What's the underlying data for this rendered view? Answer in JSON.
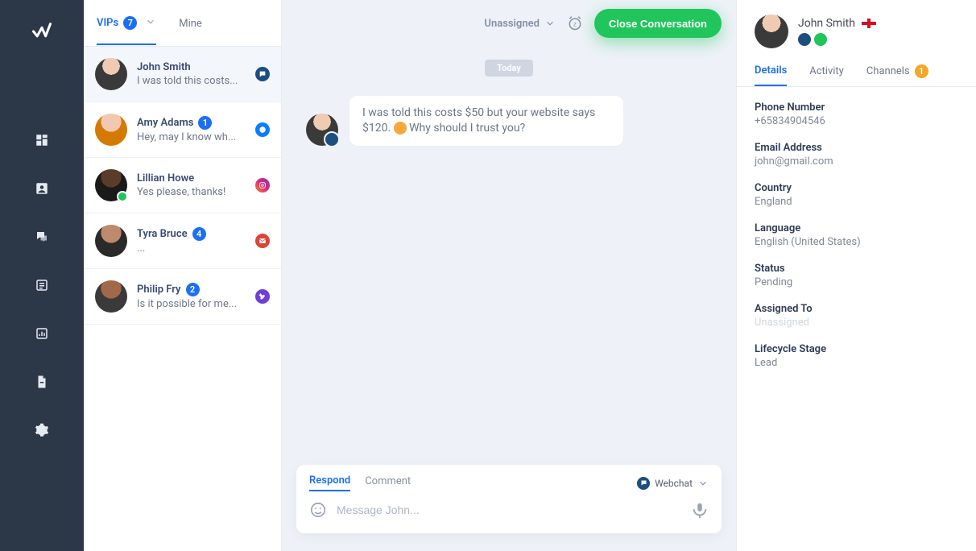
{
  "leftnav_icons": [
    "dashboard",
    "contact",
    "chat",
    "list",
    "stats",
    "file",
    "settings"
  ],
  "tabs": {
    "vips": "VIPs",
    "vips_count": "7",
    "mine": "Mine"
  },
  "conversations": [
    {
      "name": "John Smith",
      "preview": "I was told this costs...",
      "channel": "webchat"
    },
    {
      "name": "Amy Adams",
      "preview": "Hey, may I know wh...",
      "channel": "messenger",
      "badge": "1"
    },
    {
      "name": "Lillian Howe",
      "preview": "Yes please, thanks!",
      "channel": "instagram",
      "presence": true
    },
    {
      "name": "Tyra Bruce",
      "preview": "...",
      "channel": "gmail",
      "badge": "4"
    },
    {
      "name": "Philip Fry",
      "preview": "Is it possible for me...",
      "channel": "viber",
      "badge": "2"
    }
  ],
  "chat_header": {
    "unassigned": "Unassigned",
    "close_conversation": "Close Conversation"
  },
  "chat": {
    "day_label": "Today",
    "message_1a": "I was told this costs $50 but your website says $120. ",
    "message_1b": " Why should I trust you?"
  },
  "composer": {
    "respond": "Respond",
    "comment": "Comment",
    "channel_label": "Webchat",
    "placeholder": "Message John..."
  },
  "profile": {
    "name": "John Smith"
  },
  "right_tabs": {
    "details": "Details",
    "activity": "Activity",
    "channels": "Channels",
    "channels_badge": "1"
  },
  "details": {
    "phone_label": "Phone Number",
    "phone": "+65834904546",
    "email_label": "Email Address",
    "email": "john@gmail.com",
    "country_label": "Country",
    "country": "England",
    "language_label": "Language",
    "language": "English (United States)",
    "status_label": "Status",
    "status": "Pending",
    "assigned_label": "Assigned To",
    "assigned": "Unassigned",
    "lifecycle_label": "Lifecycle Stage",
    "lifecycle": "Lead"
  }
}
